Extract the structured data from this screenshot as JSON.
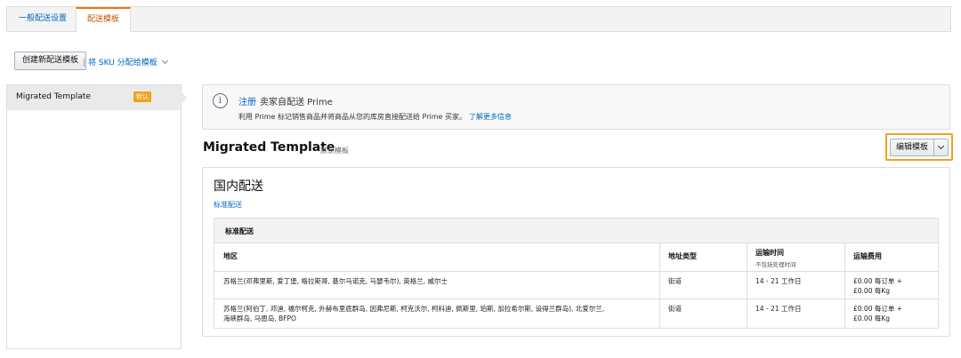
{
  "tabs": [
    {
      "label": "一般配送设置"
    },
    {
      "label": "配送模板"
    }
  ],
  "toolbar": {
    "create_label": "创建新配送模板",
    "separator": "|",
    "sku_label": "将 SKU 分配给模板"
  },
  "sidebar": {
    "items": [
      {
        "label": "Migrated Template",
        "badge": "默认"
      }
    ]
  },
  "info": {
    "register": "注册",
    "title": "卖家自配送 Prime",
    "desc": "利用 Prime 标记销售商品并将商品从您的库房直接配送给 Prime 买家。",
    "learn_more": "了解更多信息"
  },
  "template": {
    "title": "Migrated Template",
    "default_label": "默认模板",
    "edit_label": "编辑模板"
  },
  "domestic": {
    "title": "国内配送",
    "standard_link": "标准配送",
    "table_title": "标准配送",
    "columns": {
      "region": "地区",
      "address_type": "地址类型",
      "transit": "运输时间",
      "transit_sub": "不包括处理时间",
      "fee": "运输费用"
    },
    "rows": [
      {
        "region": "苏格兰(邓弗里斯, 爱丁堡, 格拉斯哥, 基尔马诺克, 马瑟韦尔), 英格兰, 威尔士",
        "address_type": "街道",
        "transit": "14 - 21 工作日",
        "fee_line1": "£0.00 每订单 +",
        "fee_line2": "£0.00 每Kg"
      },
      {
        "region_line1": "苏格兰(阿伯丁, 邓迪, 福尔柯克, 外赫布里底群岛, 因弗尼斯, 柯克沃尔, 柯科迪, 佩斯里, 珀斯, 加拉希尔斯, 设得兰群岛), 北爱尔兰,",
        "region_line2": "海峡群岛, 马恩岛, BFPO",
        "address_type": "街道",
        "transit": "14 - 21 工作日",
        "fee_line1": "£0.00 每订单 +",
        "fee_line2": "£0.00 每Kg"
      }
    ]
  }
}
